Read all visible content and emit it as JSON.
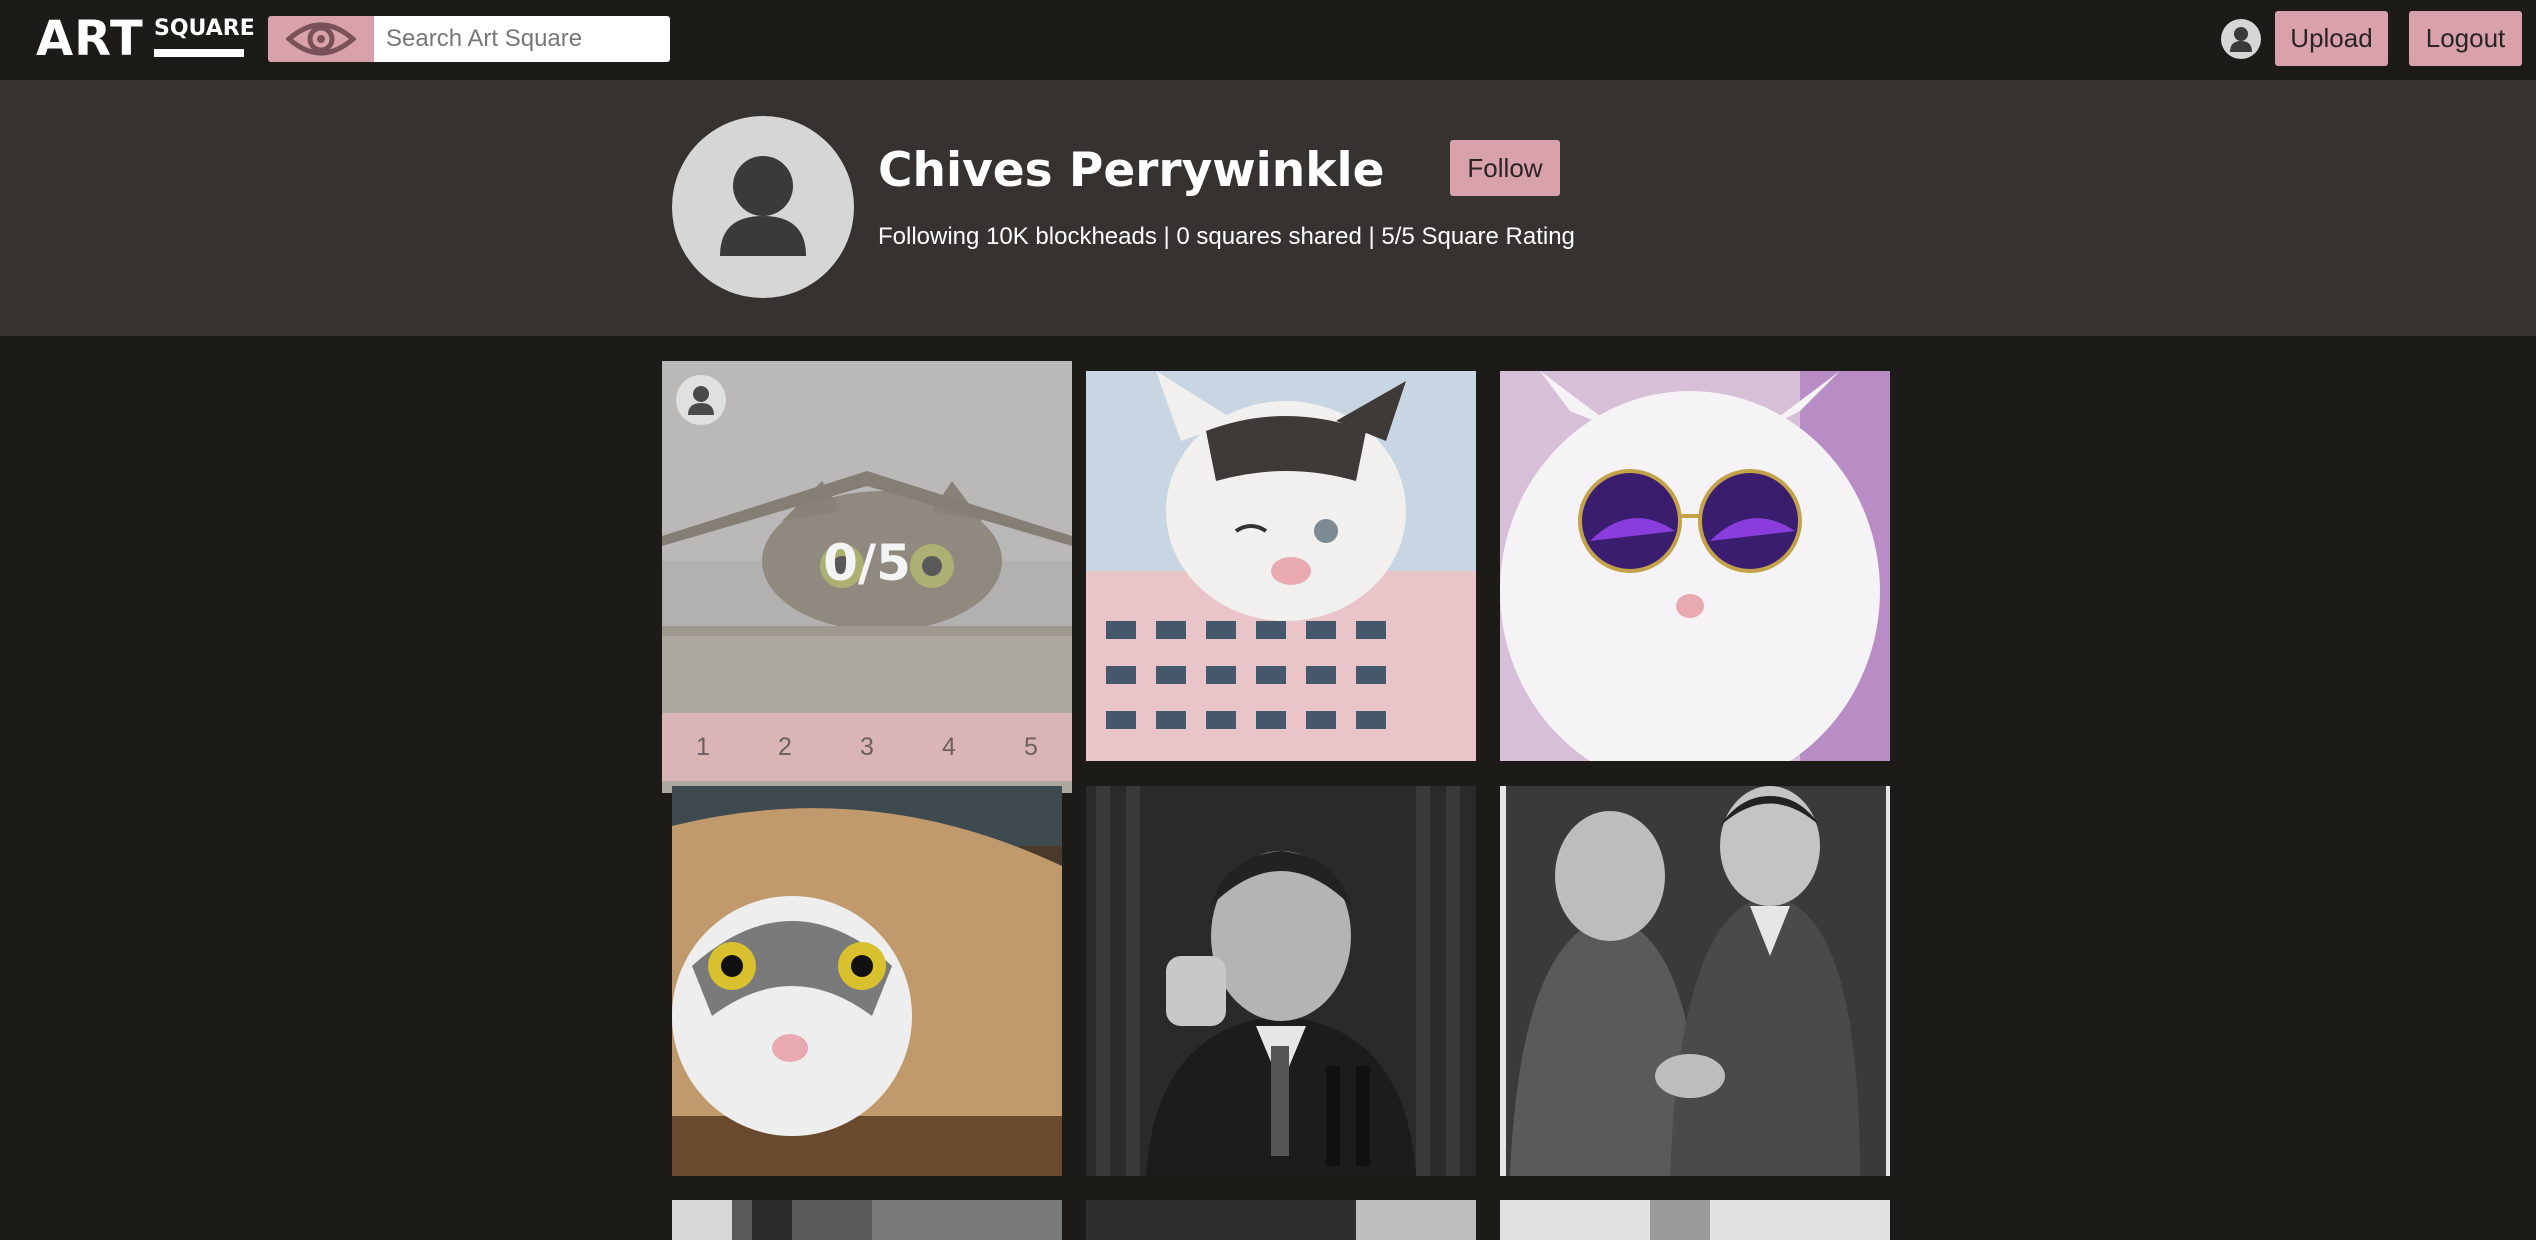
{
  "header": {
    "logo_primary": "ART",
    "logo_secondary": "SQUARE",
    "search_placeholder": "Search Art Square",
    "upload_label": "Upload",
    "logout_label": "Logout"
  },
  "profile": {
    "name": "Chives Perrywinkle",
    "follow_label": "Follow",
    "stats": "Following 10K blockheads | 0 squares shared | 5/5 Square Rating"
  },
  "featured_tile": {
    "rating": "0/5",
    "rating_options": [
      "1",
      "2",
      "3",
      "4",
      "5"
    ]
  },
  "icons": [
    "eye-icon",
    "user-icon"
  ],
  "colors": {
    "background": "#1d1b18",
    "banner": "#353230",
    "accent_pink": "#d8a1ab"
  }
}
